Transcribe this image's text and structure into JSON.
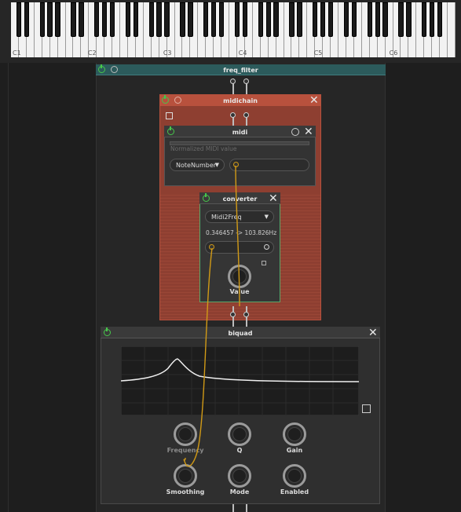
{
  "piano": {
    "octave_labels": [
      "C1",
      "C2",
      "C3",
      "C4",
      "C5",
      "C6"
    ]
  },
  "freq_filter": {
    "title": "freq_filter"
  },
  "midichain": {
    "title": "midichain"
  },
  "midi": {
    "title": "midi",
    "value_label": "Normalized MIDI value",
    "source_select": "NoteNumber"
  },
  "converter": {
    "title": "converter",
    "mode_select": "Midi2Freq",
    "readout": "0.346457 -> 103.826Hz",
    "knob_label": "Value",
    "knob_value": 0.35
  },
  "biquad": {
    "title": "biquad",
    "knobs": [
      {
        "label": "Frequency"
      },
      {
        "label": "Q"
      },
      {
        "label": "Gain"
      },
      {
        "label": "Smoothing"
      },
      {
        "label": "Mode"
      },
      {
        "label": "Enabled"
      }
    ]
  },
  "colors": {
    "power_green": "#47c64b",
    "freq_filter_header": "#2c5b5c",
    "midichain_header": "#b8513d",
    "midichain_body": "#8e3f31",
    "converter_border": "#58a86a",
    "cable": "#d19a16"
  }
}
